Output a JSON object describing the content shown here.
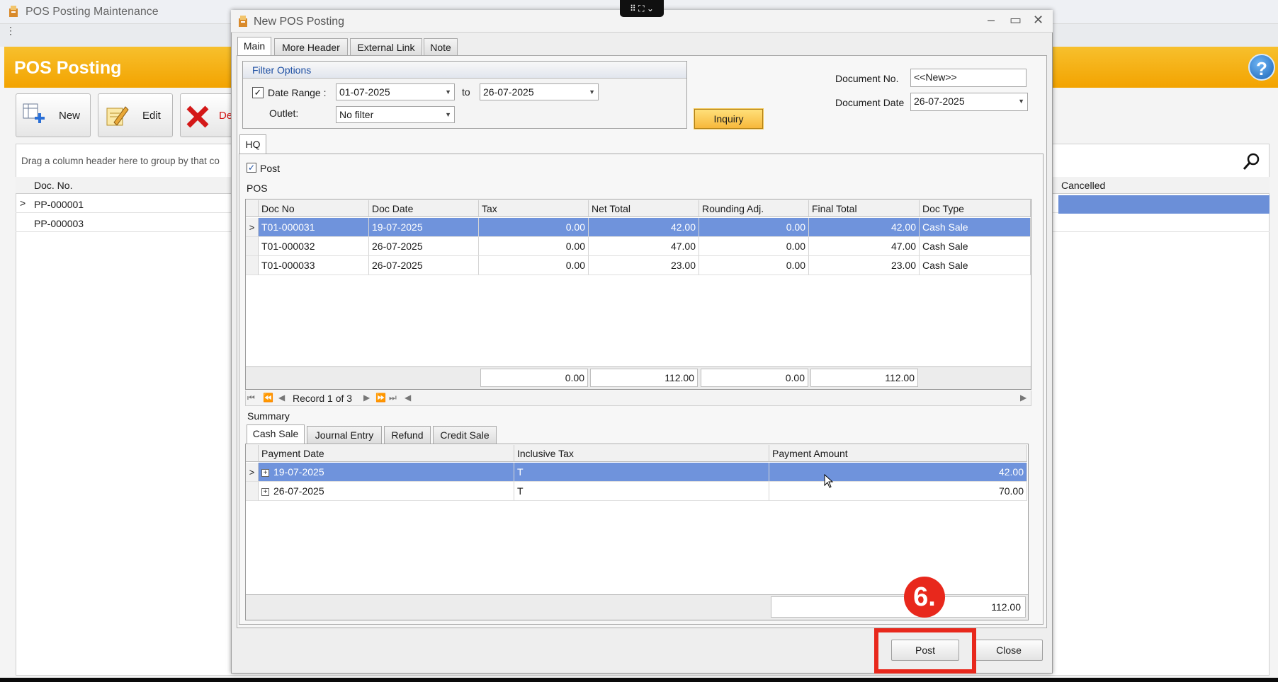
{
  "window": {
    "title": "POS Posting Maintenance"
  },
  "header": {
    "title": "POS Posting",
    "help_icon": "?"
  },
  "toolbar": {
    "new_label": "New",
    "edit_label": "Edit",
    "delete_label": "De"
  },
  "bg_grid": {
    "drag_hint": "Drag a column header here to group by that co",
    "col_docno": "Doc. No.",
    "col_cancelled": "Cancelled",
    "rows": [
      "PP-000001",
      "PP-000003"
    ]
  },
  "dialog": {
    "title": "New POS Posting",
    "tabs": [
      "Main",
      "More Header",
      "External Link",
      "Note"
    ],
    "filter": {
      "title": "Filter Options",
      "date_range_label": "Date Range :",
      "date_range_checked": true,
      "from": "01-07-2025",
      "to_label": "to",
      "to": "26-07-2025",
      "outlet_label": "Outlet:",
      "outlet": "No filter"
    },
    "inquiry_label": "Inquiry",
    "doc_no_label": "Document No.",
    "doc_no": "<<New>>",
    "doc_date_label": "Document Date",
    "doc_date": "26-07-2025",
    "hq_tab": "HQ",
    "post_label": "Post",
    "pos_label": "POS",
    "pos_grid": {
      "columns": [
        "Doc No",
        "Doc Date",
        "Tax",
        "Net Total",
        "Rounding Adj.",
        "Final Total",
        "Doc Type"
      ],
      "rows": [
        [
          "T01-000031",
          "19-07-2025",
          "0.00",
          "42.00",
          "0.00",
          "42.00",
          "Cash Sale"
        ],
        [
          "T01-000032",
          "26-07-2025",
          "0.00",
          "47.00",
          "0.00",
          "47.00",
          "Cash Sale"
        ],
        [
          "T01-000033",
          "26-07-2025",
          "0.00",
          "23.00",
          "0.00",
          "23.00",
          "Cash Sale"
        ]
      ],
      "totals": {
        "tax": "0.00",
        "net": "112.00",
        "rounding": "0.00",
        "final": "112.00"
      },
      "record_text": "Record 1 of 3"
    },
    "summary_label": "Summary",
    "summary_tabs": [
      "Cash Sale",
      "Journal Entry",
      "Refund",
      "Credit Sale"
    ],
    "summary_grid": {
      "columns": [
        "Payment Date",
        "Inclusive Tax",
        "Payment Amount"
      ],
      "rows": [
        [
          "19-07-2025",
          "T",
          "42.00"
        ],
        [
          "26-07-2025",
          "T",
          "70.00"
        ]
      ],
      "total": "112.00"
    },
    "step_badge": "6.",
    "post_button": "Post",
    "close_button": "Close"
  },
  "colors": {
    "header_orange": "#f3a300",
    "selection_blue": "#6f93dc",
    "highlight_red": "#e8281c",
    "inquiry_yellow": "#f7b83b"
  }
}
